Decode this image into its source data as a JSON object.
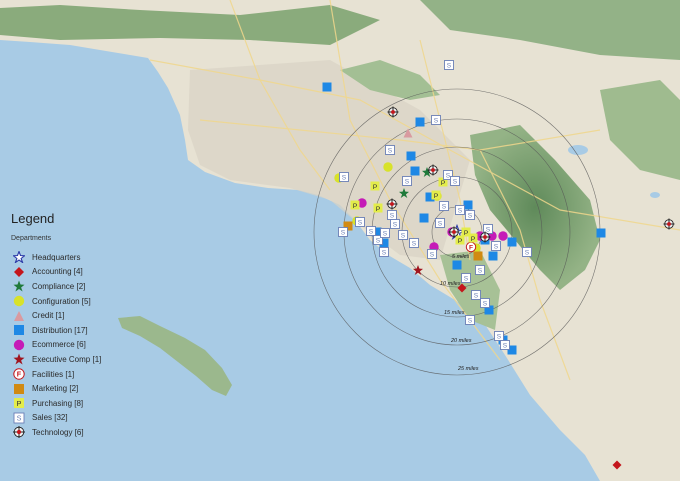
{
  "map": {
    "region": "Los Angeles / Orange County coastal map",
    "colors": {
      "ocean": "#a8cbe5",
      "land": "#e7e2d3",
      "urban": "#d9d5c8",
      "mountains": "#7fa276",
      "road": "#f2d98a"
    }
  },
  "legend": {
    "title": "Legend",
    "subtitle": "Departments",
    "items": [
      {
        "label": "Headquarters",
        "icon": "headquarters-star-icon"
      },
      {
        "label": "Accounting [4]",
        "icon": "accounting-diamond-icon"
      },
      {
        "label": "Compliance [2]",
        "icon": "compliance-star-icon"
      },
      {
        "label": "Configuration [5]",
        "icon": "configuration-circle-icon"
      },
      {
        "label": "Credit  [1]",
        "icon": "credit-triangle-icon"
      },
      {
        "label": "Distribution [17]",
        "icon": "distribution-square-icon"
      },
      {
        "label": "Ecommerce [6]",
        "icon": "ecommerce-circle-icon"
      },
      {
        "label": "Executive Comp [1]",
        "icon": "executive-comp-star-icon"
      },
      {
        "label": "Facilities  [1]",
        "icon": "facilities-f-icon"
      },
      {
        "label": "Marketing  [2]",
        "icon": "marketing-square-icon"
      },
      {
        "label": "Purchasing  [8]",
        "icon": "purchasing-p-icon"
      },
      {
        "label": "Sales [32]",
        "icon": "sales-s-icon"
      },
      {
        "label": "Technology  [6]",
        "icon": "technology-crosshair-icon"
      }
    ]
  },
  "rings": {
    "labels": [
      "5 miles",
      "10 miles",
      "15 miles",
      "20 miles",
      "25 miles"
    ]
  }
}
